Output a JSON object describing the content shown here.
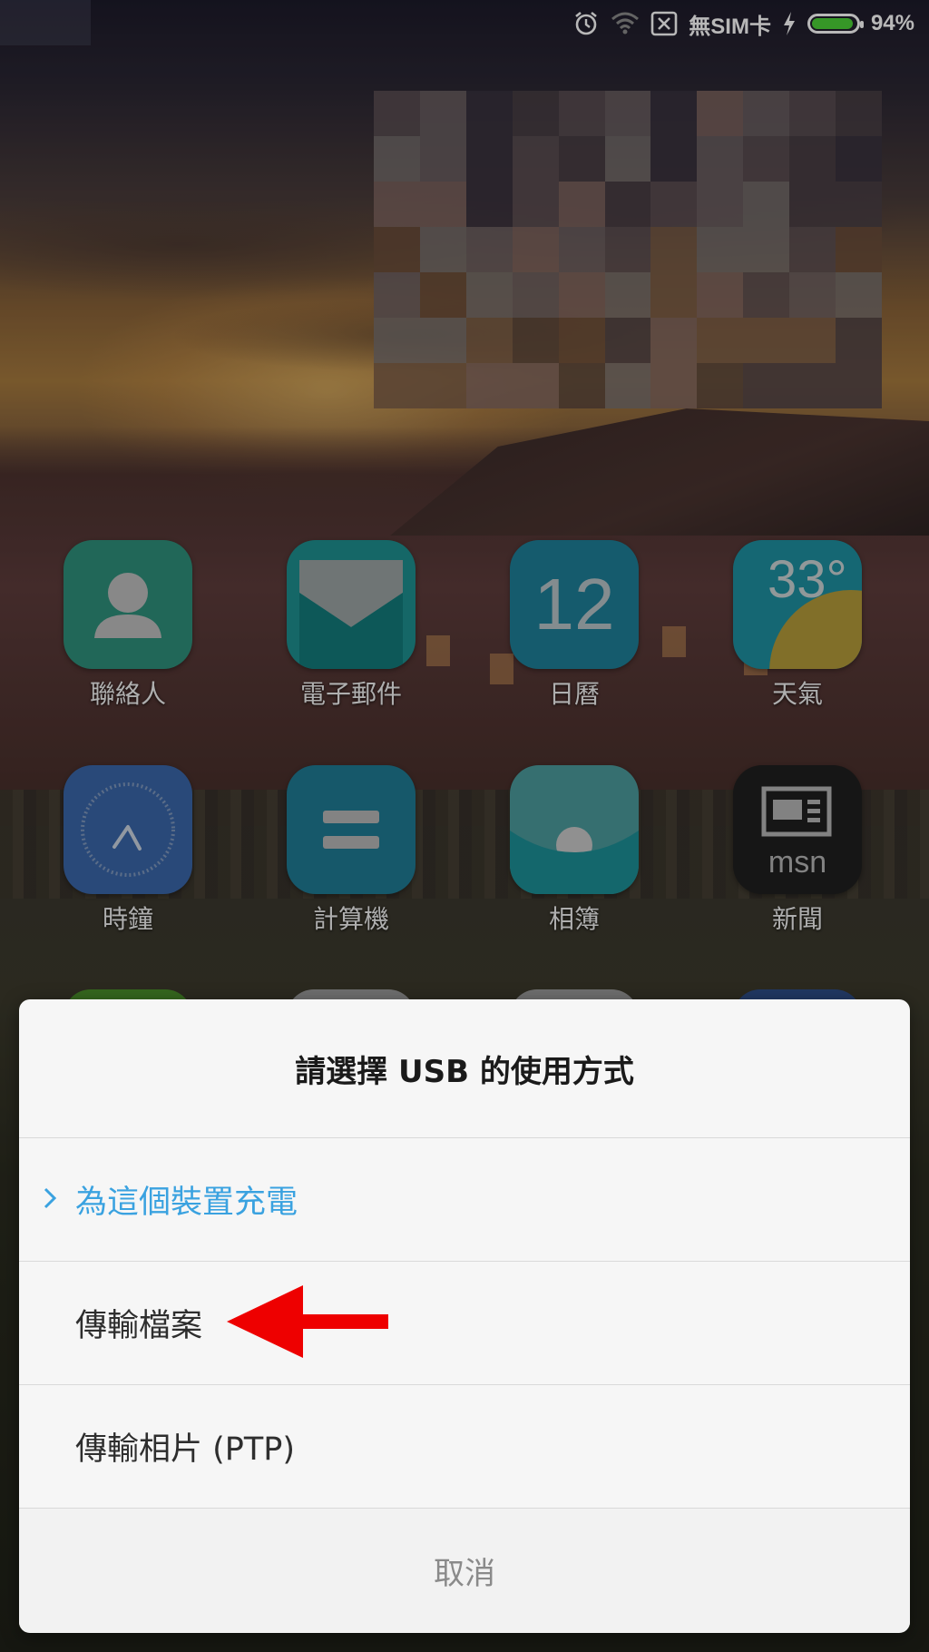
{
  "status_bar": {
    "sim_text": "無SIM卡",
    "battery_percent": "94%",
    "battery_level": 0.94,
    "icons": [
      "alarm-icon",
      "wifi-icon",
      "sim-blocked-icon",
      "charging-icon",
      "battery-icon"
    ]
  },
  "apps": [
    {
      "label": "聯絡人",
      "icon": "contacts-icon",
      "color": "#2f8f7a"
    },
    {
      "label": "電子郵件",
      "icon": "email-icon",
      "color": "#1e8f8f"
    },
    {
      "label": "日曆",
      "icon": "calendar-icon",
      "color": "#1e7f97",
      "icon_text": "12"
    },
    {
      "label": "天氣",
      "icon": "weather-icon",
      "color": "#1e8fa0",
      "icon_text": "33°"
    },
    {
      "label": "時鐘",
      "icon": "clock-icon",
      "color": "#3a66a8"
    },
    {
      "label": "計算機",
      "icon": "calculator-icon",
      "color": "#1f7a93"
    },
    {
      "label": "相簿",
      "icon": "gallery-icon",
      "color": "#2b9aa3"
    },
    {
      "label": "新聞",
      "icon": "news-icon",
      "color": "#1f1f1f",
      "icon_text": "msn"
    }
  ],
  "dialog": {
    "title": "請選擇 USB 的使用方式",
    "options": [
      {
        "label": "為這個裝置充電",
        "selected": true
      },
      {
        "label": "傳輸檔案",
        "selected": false
      },
      {
        "label": "傳輸相片 (PTP)",
        "selected": false
      }
    ],
    "cancel_label": "取消"
  },
  "colors": {
    "accent": "#3aa2e0",
    "annotation_arrow": "#ee0000",
    "battery_fill": "#4cd137"
  }
}
